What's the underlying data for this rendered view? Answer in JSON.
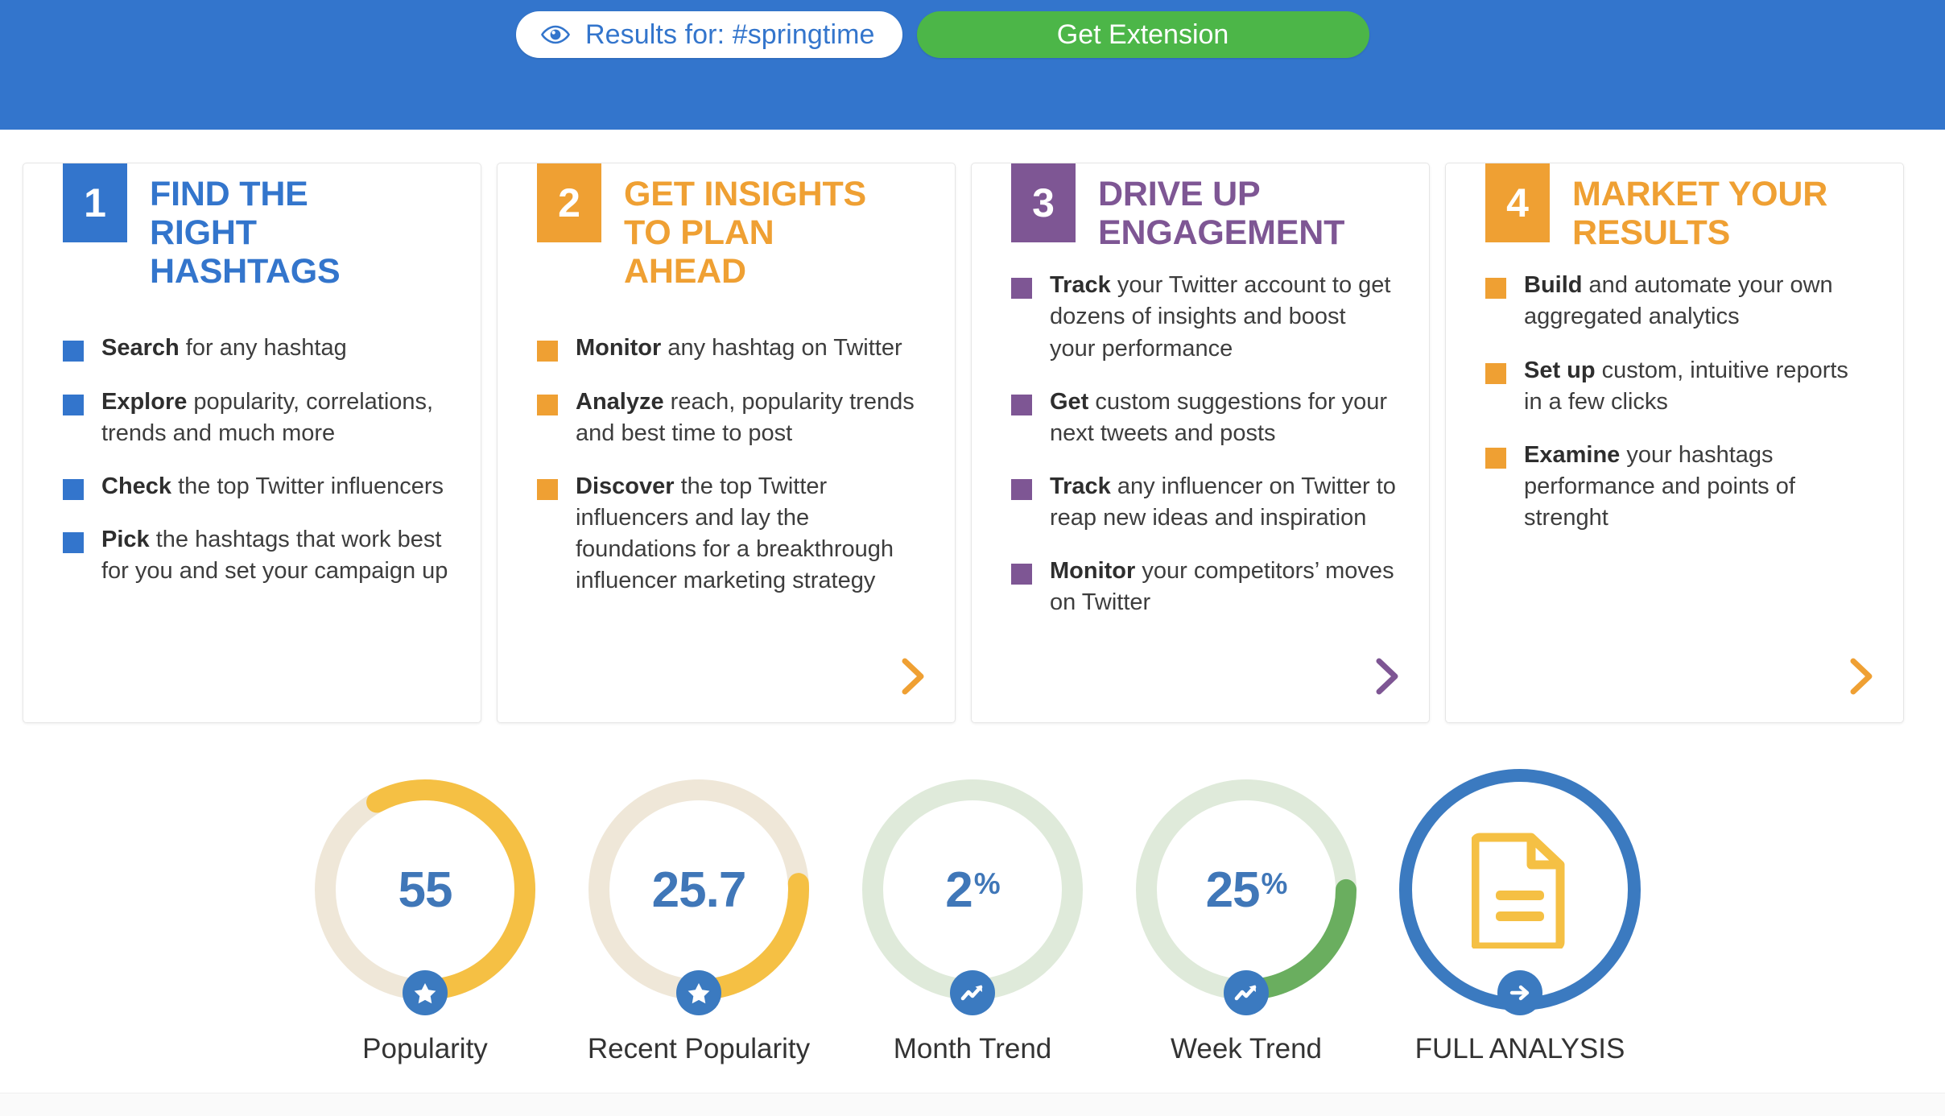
{
  "header": {
    "results_pill": {
      "icon": "eye-icon",
      "label": "Results for: #springtime"
    },
    "get_extension_label": "Get Extension",
    "band_color": "#3375cc",
    "button_color": "#4cb648"
  },
  "cards": [
    {
      "number": "1",
      "title": "FIND THE RIGHT HASHTAGS",
      "accent": "#3375cc",
      "bullets": [
        {
          "lead": "Search",
          "rest": " for any hashtag"
        },
        {
          "lead": "Explore",
          "rest": " popularity, correlations, trends and much more"
        },
        {
          "lead": "Check",
          "rest": " the top Twitter influencers"
        },
        {
          "lead": "Pick",
          "rest": " the hashtags that work best for you and set your campaign up"
        }
      ],
      "has_arrow": false
    },
    {
      "number": "2",
      "title": "GET INSIGHTS TO PLAN AHEAD",
      "accent": "#efa033",
      "bullets": [
        {
          "lead": "Monitor",
          "rest": " any hashtag on Twitter"
        },
        {
          "lead": "Analyze",
          "rest": " reach, popularity trends and best time to post"
        },
        {
          "lead": "Discover",
          "rest": " the top Twitter influencers and lay the foundations for a breakthrough influencer marketing strategy"
        }
      ],
      "has_arrow": true
    },
    {
      "number": "3",
      "title": "DRIVE UP ENGAGEMENT",
      "accent": "#7e5694",
      "bullets": [
        {
          "lead": "Track",
          "rest": " your Twitter account to get dozens of insights and boost your performance"
        },
        {
          "lead": "Get",
          "rest": " custom suggestions for your next tweets and posts"
        },
        {
          "lead": "Track",
          "rest": " any influencer on Twitter to reap new ideas and inspiration"
        },
        {
          "lead": "Monitor",
          "rest": " your competitors’ moves on Twitter"
        }
      ],
      "has_arrow": true
    },
    {
      "number": "4",
      "title": "MARKET YOUR RESULTS",
      "accent": "#efa033",
      "bullets": [
        {
          "lead": "Build",
          "rest": " and automate your own aggregated analytics"
        },
        {
          "lead": "Set up",
          "rest": " custom, intuitive reports in a few clicks"
        },
        {
          "lead": "Examine",
          "rest": " your hashtags performance and points of strenght"
        }
      ],
      "has_arrow": true
    }
  ],
  "metrics": [
    {
      "value": "55",
      "unit": "",
      "label": "Popularity",
      "percent": 58,
      "arc_color": "#f5c044",
      "track_color": "#efe7d8",
      "badge_icon": "star-icon"
    },
    {
      "value": "25.7",
      "unit": "",
      "label": "Recent Popularity",
      "percent": 26,
      "arc_color": "#f5c044",
      "track_color": "#efe7d8",
      "badge_icon": "star-icon"
    },
    {
      "value": "2",
      "unit": "%",
      "label": "Month Trend",
      "percent": 2,
      "arc_color": "#6aae5f",
      "track_color": "#dfeada",
      "badge_icon": "trend-up-icon"
    },
    {
      "value": "25",
      "unit": "%",
      "label": "Week Trend",
      "percent": 25,
      "arc_color": "#6aae5f",
      "track_color": "#dfeada",
      "badge_icon": "trend-up-icon"
    }
  ],
  "full_analysis": {
    "label": "FULL ANALYSIS",
    "ring_color": "#3b7ac0",
    "doc_color": "#f5c044",
    "badge_icon": "arrow-right-icon",
    "doc_icon": "document-icon"
  }
}
